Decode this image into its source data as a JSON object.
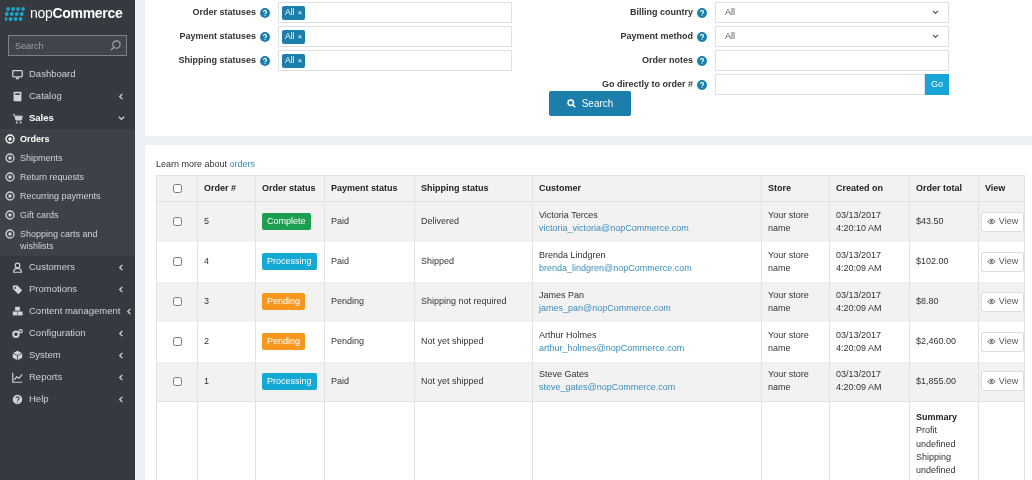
{
  "brand": "nop**Commerce**",
  "search": {
    "placeholder": "Search"
  },
  "menu": [
    {
      "label": "Dashboard",
      "kind": "link"
    },
    {
      "label": "Catalog",
      "kind": "group",
      "expanded": false
    },
    {
      "label": "Sales",
      "kind": "group",
      "expanded": true,
      "children": [
        {
          "label": "Orders",
          "selected": true
        },
        {
          "label": "Shipments",
          "selected": false
        },
        {
          "label": "Return requests",
          "selected": false
        },
        {
          "label": "Recurring payments",
          "selected": false
        },
        {
          "label": "Gift cards",
          "selected": false
        },
        {
          "label": "Shopping carts and wishlists",
          "selected": false
        }
      ]
    },
    {
      "label": "Customers",
      "kind": "group",
      "expanded": false
    },
    {
      "label": "Promotions",
      "kind": "group",
      "expanded": false
    },
    {
      "label": "Content management",
      "kind": "group",
      "expanded": false
    },
    {
      "label": "Configuration",
      "kind": "group",
      "expanded": false
    },
    {
      "label": "System",
      "kind": "group",
      "expanded": false
    },
    {
      "label": "Reports",
      "kind": "group",
      "expanded": false
    },
    {
      "label": "Help",
      "kind": "group",
      "expanded": false
    }
  ],
  "filters": {
    "left": [
      {
        "label": "Order statuses",
        "kind": "tags",
        "tags": [
          {
            "label": "All",
            "remove": "×"
          }
        ]
      },
      {
        "label": "Payment statuses",
        "kind": "tags",
        "tags": [
          {
            "label": "All",
            "remove": "×"
          }
        ]
      },
      {
        "label": "Shipping statuses",
        "kind": "tags",
        "tags": [
          {
            "label": "All",
            "remove": "×"
          }
        ]
      }
    ],
    "right": [
      {
        "label": "Billing country",
        "kind": "select",
        "value": "All"
      },
      {
        "label": "Payment method",
        "kind": "select",
        "value": "All"
      },
      {
        "label": "Order notes",
        "kind": "text"
      },
      {
        "label": "Go directly to order #",
        "kind": "go",
        "button": "Go"
      }
    ]
  },
  "search_button": "Search",
  "learn_more": {
    "text": "Learn more about",
    "link": "orders"
  },
  "table": {
    "header_checked": false,
    "columns": [
      "Order #",
      "Order status",
      "Payment status",
      "Shipping status",
      "Customer",
      "Store",
      "Created on",
      "Order total",
      "View"
    ],
    "rows": [
      {
        "checked": false,
        "order": "5",
        "status": {
          "label": "Complete",
          "color": "#1e9e50"
        },
        "payment": "Paid",
        "shipping": "Delivered",
        "customer": "Victoria Terces",
        "email": "victoria_victoria@nopCommerce.com",
        "store": "Your store name",
        "created": "03/13/2017 4:20:10 AM",
        "total": "$43.50",
        "view": "View"
      },
      {
        "checked": false,
        "order": "4",
        "status": {
          "label": "Processing",
          "color": "#14a9d2"
        },
        "payment": "Paid",
        "shipping": "Shipped",
        "customer": "Brenda Lindgren",
        "email": "brenda_lindgren@nopCommerce.com",
        "store": "Your store name",
        "created": "03/13/2017 4:20:09 AM",
        "total": "$102.00",
        "view": "View"
      },
      {
        "checked": false,
        "order": "3",
        "status": {
          "label": "Pending",
          "color": "#f7971e"
        },
        "payment": "Pending",
        "shipping": "Shipping not required",
        "customer": "James Pan",
        "email": "james_pan@nopCommerce.com",
        "store": "Your store name",
        "created": "03/13/2017 4:20:09 AM",
        "total": "$8.80",
        "view": "View"
      },
      {
        "checked": false,
        "order": "2",
        "status": {
          "label": "Pending",
          "color": "#f7971e"
        },
        "payment": "Pending",
        "shipping": "Not yet shipped",
        "customer": "Arthur Holmes",
        "email": "arthur_holmes@nopCommerce.com",
        "store": "Your store name",
        "created": "03/13/2017 4:20:09 AM",
        "total": "$2,460.00",
        "view": "View"
      },
      {
        "checked": false,
        "order": "1",
        "status": {
          "label": "Processing",
          "color": "#14a9d2"
        },
        "payment": "Paid",
        "shipping": "Not yet shipped",
        "customer": "Steve Gates",
        "email": "steve_gates@nopCommerce.com",
        "store": "Your store name",
        "created": "03/13/2017 4:20:09 AM",
        "total": "$1,855.00",
        "view": "View"
      }
    ],
    "summary": [
      {
        "text": "Summary",
        "kind": "heading"
      },
      {
        "text": "Profit",
        "kind": "line"
      },
      {
        "text": "undefined",
        "kind": "line"
      },
      {
        "text": "Shipping",
        "kind": "line"
      },
      {
        "text": "undefined",
        "kind": "line"
      }
    ]
  }
}
